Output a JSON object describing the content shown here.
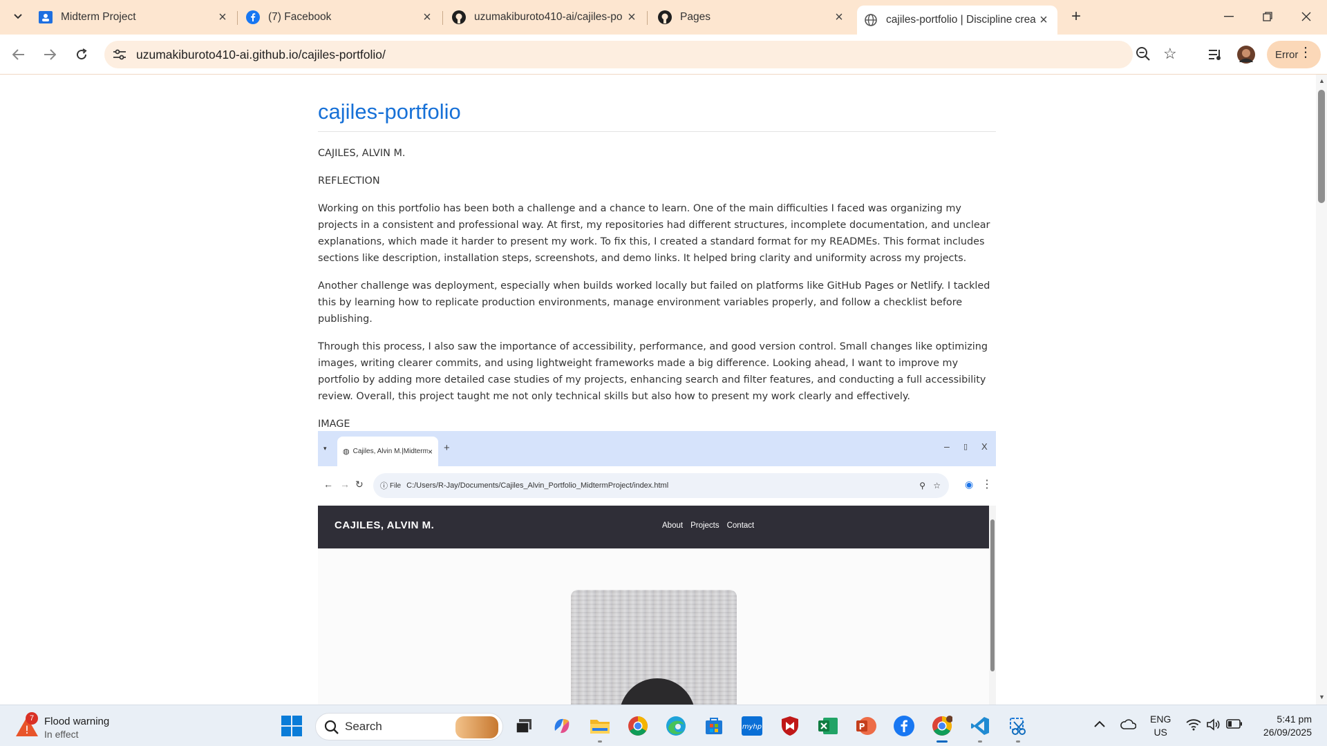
{
  "browser": {
    "tabs": [
      {
        "title": "Midterm Project",
        "icon": "google-classroom-icon"
      },
      {
        "title": "(7) Facebook",
        "icon": "facebook-icon"
      },
      {
        "title": "uzumakiburoto410-ai/cajiles-po",
        "icon": "github-icon"
      },
      {
        "title": "Pages",
        "icon": "github-icon"
      },
      {
        "title": "cajiles-portfolio | Discipline crea",
        "icon": "globe-icon",
        "active": true
      }
    ],
    "url": "uzumakiburoto410-ai.github.io/cajiles-portfolio/",
    "profile_status": "Error"
  },
  "page": {
    "title": "cajiles-portfolio",
    "author": "CAJILES, ALVIN M.",
    "section": "REFLECTION",
    "paragraphs": [
      "Working on this portfolio has been both a challenge and a chance to learn. One of the main difficulties I faced was organizing my projects in a consistent and professional way. At first, my repositories had different structures, incomplete documentation, and unclear explanations, which made it harder to present my work. To fix this, I created a standard format for my READMEs. This format includes sections like description, installation steps, screenshots, and demo links. It helped bring clarity and uniformity across my projects.",
      "Another challenge was deployment, especially when builds worked locally but failed on platforms like GitHub Pages or Netlify. I tackled this by learning how to replicate production environments, manage environment variables properly, and follow a checklist before publishing.",
      "Through this process, I also saw the importance of accessibility, performance, and good version control. Small changes like optimizing images, writing clearer commits, and using lightweight frameworks made a big difference. Looking ahead, I want to improve my portfolio by adding more detailed case studies of my projects, enhancing search and filter features, and conducting a full accessibility review. Overall, this project taught me not only technical skills but also how to present my work clearly and effectively."
    ],
    "image_label": "IMAGE",
    "screenshot": {
      "tab_title": "Cajiles, Alvin M.|MidtermProje",
      "file_label": "File",
      "path": "C:/Users/R-Jay/Documents/Cajiles_Alvin_Portfolio_MidtermProject/index.html",
      "brand": "CAJILES, ALVIN M.",
      "nav_links": [
        "About",
        "Projects",
        "Contact"
      ]
    }
  },
  "taskbar": {
    "weather_title": "Flood warning",
    "weather_status": "In effect",
    "weather_badge": "7",
    "search_label": "Search",
    "language": "ENG",
    "region": "US",
    "time": "5:41 pm",
    "date": "26/09/2025"
  },
  "colors": {
    "tab_strip": "#fde6d0",
    "title_link": "#1670d7",
    "site_nav": "#2f2e37"
  }
}
